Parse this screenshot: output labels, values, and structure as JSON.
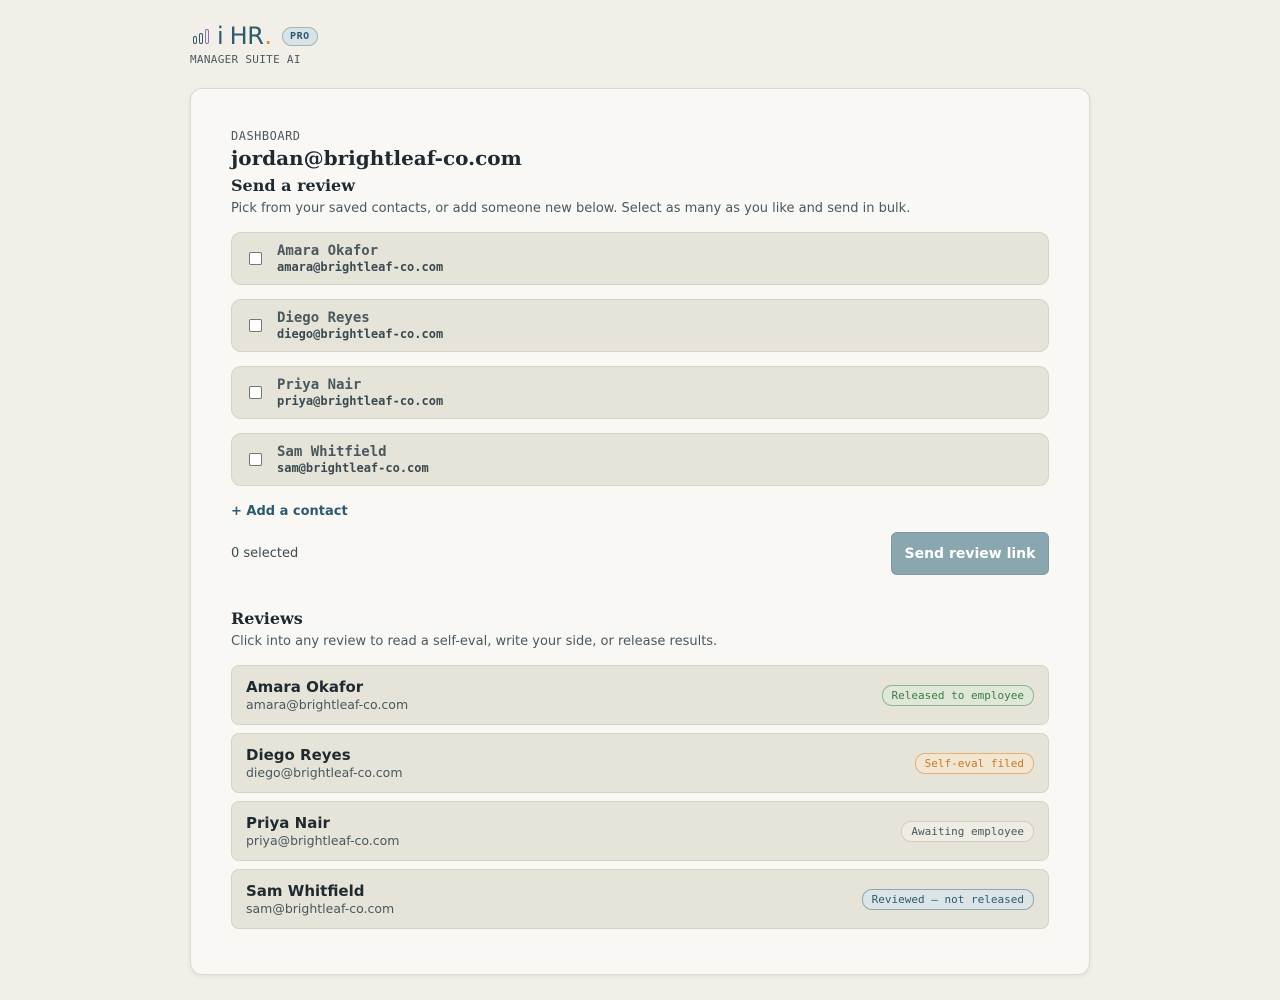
{
  "brand": {
    "name_i": "i",
    "name_hr": "HR",
    "name_dot": ".",
    "badge": "PRO",
    "subtitle": "MANAGER SUITE AI"
  },
  "dashboard": {
    "eyebrow": "DASHBOARD",
    "user_email": "jordan@brightleaf-co.com"
  },
  "send_review": {
    "title": "Send a review",
    "description": "Pick from your saved contacts, or add someone new below. Select as many as you like and send in bulk.",
    "contacts": [
      {
        "name": "Amara Okafor",
        "email": "amara@brightleaf-co.com",
        "checked": false
      },
      {
        "name": "Diego Reyes",
        "email": "diego@brightleaf-co.com",
        "checked": false
      },
      {
        "name": "Priya Nair",
        "email": "priya@brightleaf-co.com",
        "checked": false
      },
      {
        "name": "Sam Whitfield",
        "email": "sam@brightleaf-co.com",
        "checked": false
      }
    ],
    "add_contact_label": "+ Add a contact",
    "selected_count": "0 selected",
    "send_button_label": "Send review link"
  },
  "reviews": {
    "title": "Reviews",
    "description": "Click into any review to read a self-eval, write your side, or release results.",
    "items": [
      {
        "name": "Amara Okafor",
        "email": "amara@brightleaf-co.com",
        "status": "Released to employee",
        "status_color": "#3d7a4a"
      },
      {
        "name": "Diego Reyes",
        "email": "diego@brightleaf-co.com",
        "status": "Self-eval filed",
        "status_color": "#c47a2c"
      },
      {
        "name": "Priya Nair",
        "email": "priya@brightleaf-co.com",
        "status": "Awaiting employee",
        "status_color": "#4a5860"
      },
      {
        "name": "Sam Whitfield",
        "email": "sam@brightleaf-co.com",
        "status": "Reviewed — not released",
        "status_color": "#2e5a6e"
      }
    ]
  },
  "colors": {
    "accent": "#2e5a6e",
    "background": "#f2efe9",
    "card": "#faf8f4",
    "button_disabled": "#8aa6ae"
  }
}
